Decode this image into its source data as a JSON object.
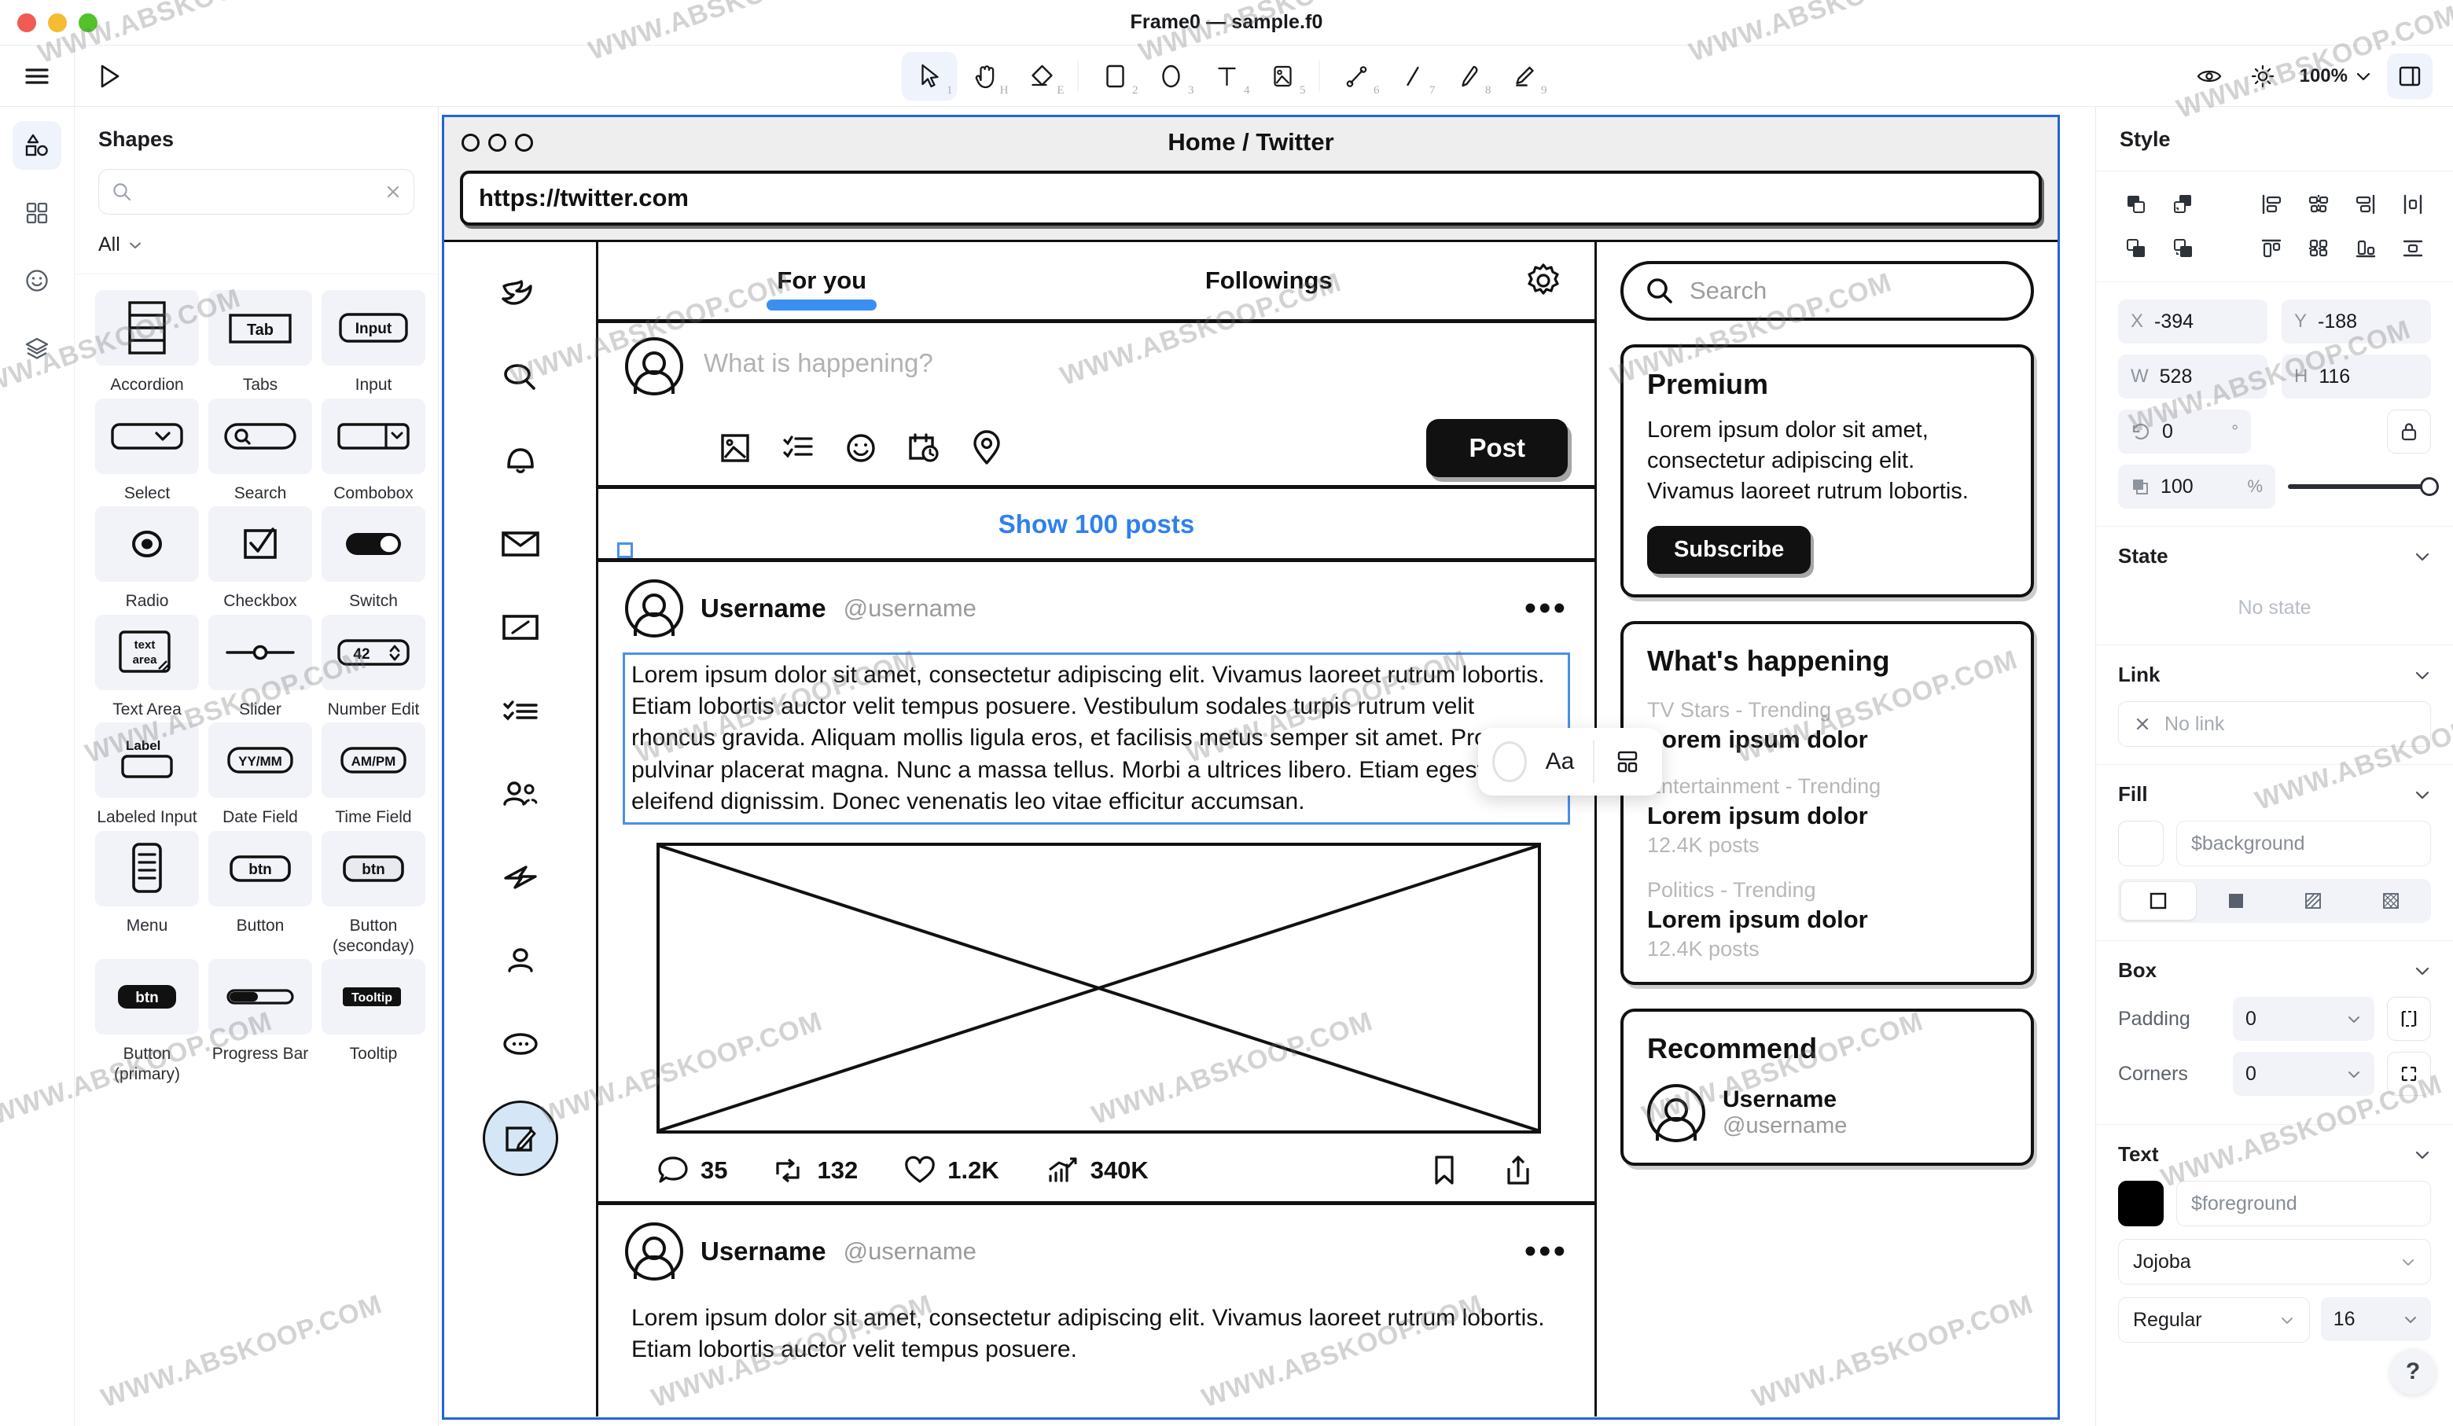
{
  "window": {
    "title": "Frame0 — sample.f0"
  },
  "toolbar": {
    "tools": [
      {
        "name": "select-tool",
        "key": "1"
      },
      {
        "name": "hand-tool",
        "key": "H"
      },
      {
        "name": "eraser-tool",
        "key": "E"
      },
      {
        "name": "rectangle-tool",
        "key": "2"
      },
      {
        "name": "ellipse-tool",
        "key": "3"
      },
      {
        "name": "text-tool",
        "key": "4"
      },
      {
        "name": "image-tool",
        "key": "5"
      },
      {
        "name": "connector-tool",
        "key": "6"
      },
      {
        "name": "line-tool",
        "key": "7"
      },
      {
        "name": "pencil-tool",
        "key": "8"
      },
      {
        "name": "highlighter-tool",
        "key": "9"
      }
    ],
    "zoom": "100%"
  },
  "left_panel": {
    "title": "Shapes",
    "search_placeholder": "",
    "filter": "All",
    "shapes": [
      {
        "label": "Accordion",
        "icon": "accordion-shape"
      },
      {
        "label": "Tabs",
        "icon": "tabs-shape",
        "text": "Tab"
      },
      {
        "label": "Input",
        "icon": "input-shape",
        "text": "Input"
      },
      {
        "label": "Select",
        "icon": "select-shape"
      },
      {
        "label": "Search",
        "icon": "search-shape"
      },
      {
        "label": "Combobox",
        "icon": "combobox-shape"
      },
      {
        "label": "Radio",
        "icon": "radio-shape"
      },
      {
        "label": "Checkbox",
        "icon": "checkbox-shape"
      },
      {
        "label": "Switch",
        "icon": "switch-shape"
      },
      {
        "label": "Text Area",
        "icon": "textarea-shape",
        "text": "text area"
      },
      {
        "label": "Slider",
        "icon": "slider-shape"
      },
      {
        "label": "Number Edit",
        "icon": "number-edit-shape",
        "text": "42"
      },
      {
        "label": "Labeled Input",
        "icon": "labeled-input-shape",
        "text": "Label"
      },
      {
        "label": "Date Field",
        "icon": "date-field-shape",
        "text": "YY/MM"
      },
      {
        "label": "Time Field",
        "icon": "time-field-shape",
        "text": "AM/PM"
      },
      {
        "label": "Menu",
        "icon": "menu-shape"
      },
      {
        "label": "Button",
        "icon": "button-shape",
        "text": "btn"
      },
      {
        "label": "Button (seconday)",
        "icon": "button-secondary-shape",
        "text": "btn"
      },
      {
        "label": "Button (primary)",
        "icon": "button-primary-shape",
        "text": "btn"
      },
      {
        "label": "Progress Bar",
        "icon": "progress-bar-shape"
      },
      {
        "label": "Tooltip",
        "icon": "tooltip-shape",
        "text": "Tooltip"
      }
    ]
  },
  "canvas": {
    "browser": {
      "title": "Home / Twitter",
      "url": "https://twitter.com"
    },
    "nav_icons": [
      "twitter-bird-icon",
      "search-icon",
      "bell-icon",
      "mail-icon",
      "note-icon",
      "list-icon",
      "people-icon",
      "lightning-icon",
      "person-icon",
      "more-icon",
      "compose-icon"
    ],
    "tabs": [
      {
        "label": "For you",
        "active": true
      },
      {
        "label": "Followings",
        "active": false
      }
    ],
    "settings_icon": "gear-icon",
    "composer": {
      "placeholder": "What is happening?",
      "action_icons": [
        "image-icon",
        "poll-icon",
        "emoji-icon",
        "schedule-icon",
        "location-icon"
      ],
      "post_label": "Post"
    },
    "show_posts": "Show 100 posts",
    "tweets": [
      {
        "name": "Username",
        "handle": "@username",
        "body": "Lorem ipsum dolor sit amet, consectetur adipiscing elit. Vivamus laoreet rutrum lobortis. Etiam lobortis auctor velit tempus posuere. Vestibulum sodales turpis rutrum velit rhoncus gravida. Aliquam mollis ligula eros, et facilisis metus semper sit amet. Proin pulvinar placerat magna. Nunc a massa tellus. Morbi a ultrices libero. Etiam egestas eleifend dignissim. Donec venenatis leo vitae efficitur accumsan.",
        "selected": true,
        "stats": {
          "replies": "35",
          "retweets": "132",
          "likes": "1.2K",
          "views": "340K"
        }
      },
      {
        "name": "Username",
        "handle": "@username",
        "body": "Lorem ipsum dolor sit amet, consectetur adipiscing elit. Vivamus laoreet rutrum lobortis. Etiam lobortis auctor velit tempus posuere.",
        "selected": false
      }
    ],
    "float_toolbar": {
      "text_label": "Aa",
      "layout_icon": "layout-icon"
    },
    "aside": {
      "search_placeholder": "Search",
      "premium": {
        "title": "Premium",
        "text": "Lorem ipsum dolor sit amet, consectetur adipiscing elit. Vivamus laoreet rutrum lobortis.",
        "button": "Subscribe"
      },
      "happening": {
        "title": "What's happening",
        "items": [
          {
            "category": "TV Stars - Trending",
            "name": "Lorem ipsum dolor",
            "posts": ""
          },
          {
            "category": "Entertainment - Trending",
            "name": "Lorem ipsum dolor",
            "posts": "12.4K posts"
          },
          {
            "category": "Politics - Trending",
            "name": "Lorem ipsum dolor",
            "posts": "12.4K posts"
          }
        ]
      },
      "recommend": {
        "title": "Recommend",
        "users": [
          {
            "name": "Username",
            "handle": "@username"
          }
        ]
      }
    }
  },
  "right_panel": {
    "title": "Style",
    "geometry": {
      "x_label": "X",
      "x_value": "-394",
      "y_label": "Y",
      "y_value": "-188",
      "w_label": "W",
      "w_value": "528",
      "h_label": "H",
      "h_value": "116",
      "rotation_value": "0",
      "rotation_suffix": "°",
      "opacity_value": "100",
      "opacity_suffix": "%"
    },
    "state": {
      "title": "State",
      "empty": "No state"
    },
    "link": {
      "title": "Link",
      "value": "No link"
    },
    "fill": {
      "title": "Fill",
      "value": "$background"
    },
    "box": {
      "title": "Box",
      "padding_label": "Padding",
      "padding_value": "0",
      "corners_label": "Corners",
      "corners_value": "0"
    },
    "text": {
      "title": "Text",
      "color_value": "$foreground",
      "font_family": "Jojoba",
      "font_weight": "Regular",
      "font_size": "16"
    },
    "help_label": "?"
  },
  "watermark": {
    "text": "WWW.ABSKOOP.COM"
  }
}
